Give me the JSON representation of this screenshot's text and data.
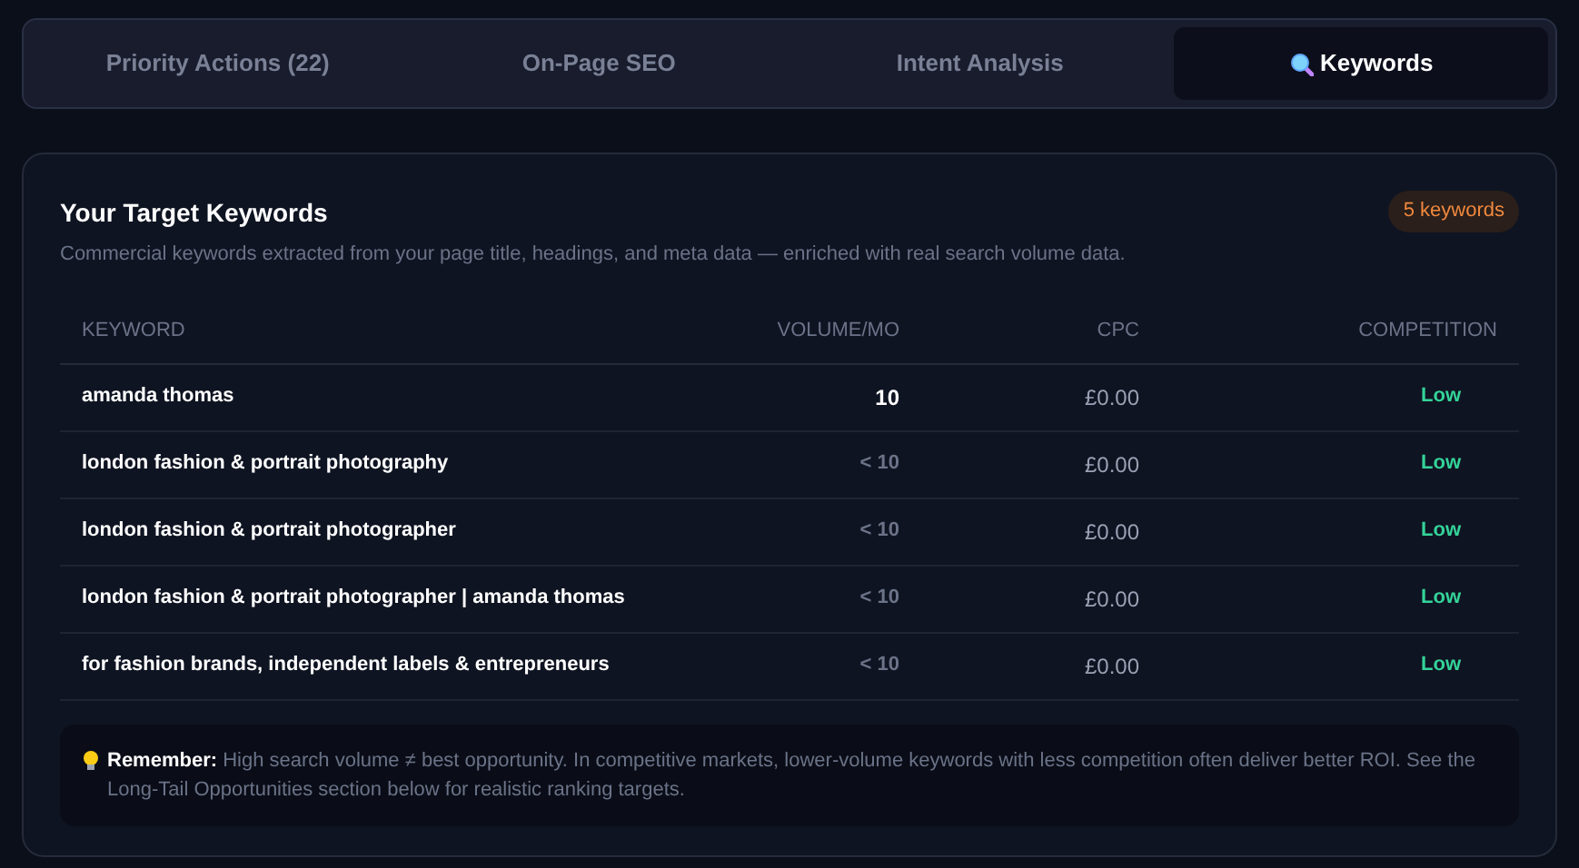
{
  "tabs": [
    {
      "label": "Priority Actions (22)",
      "selected": false,
      "icon": false
    },
    {
      "label": "On-Page SEO",
      "selected": false,
      "icon": false
    },
    {
      "label": "Intent Analysis",
      "selected": false,
      "icon": false
    },
    {
      "label": "Keywords",
      "selected": true,
      "icon": true
    }
  ],
  "card": {
    "title": "Your Target Keywords",
    "badge": "5 keywords",
    "subtitle": "Commercial keywords extracted from your page title, headings, and meta data — enriched with real search volume data."
  },
  "table": {
    "columns": [
      "KEYWORD",
      "VOLUME/MO",
      "CPC",
      "COMPETITION"
    ],
    "rows": [
      {
        "keyword": "amanda thomas",
        "volume": "10",
        "kind": "exact",
        "cpc": "£0.00",
        "competition": "Low",
        "color": "#34d399"
      },
      {
        "keyword": "london fashion & portrait photography",
        "volume": "< 10",
        "kind": "estimate",
        "cpc": "£0.00",
        "competition": "Low",
        "color": "#34d399"
      },
      {
        "keyword": "london fashion & portrait photographer",
        "volume": "< 10",
        "kind": "estimate",
        "cpc": "£0.00",
        "competition": "Low",
        "color": "#34d399"
      },
      {
        "keyword": "london fashion & portrait photographer | amanda thomas",
        "volume": "< 10",
        "kind": "estimate",
        "cpc": "£0.00",
        "competition": "Low",
        "color": "#34d399"
      },
      {
        "keyword": "for fashion brands, independent labels & entrepreneurs",
        "volume": "< 10",
        "kind": "estimate",
        "cpc": "£0.00",
        "competition": "Low",
        "color": "#34d399"
      }
    ]
  },
  "note": "**Remember:** High search volume ≠ best opportunity. In competitive markets, lower-volume keywords with less competition often deliver better ROI. See the Long-Tail Opportunities section below for realistic ranking targets."
}
